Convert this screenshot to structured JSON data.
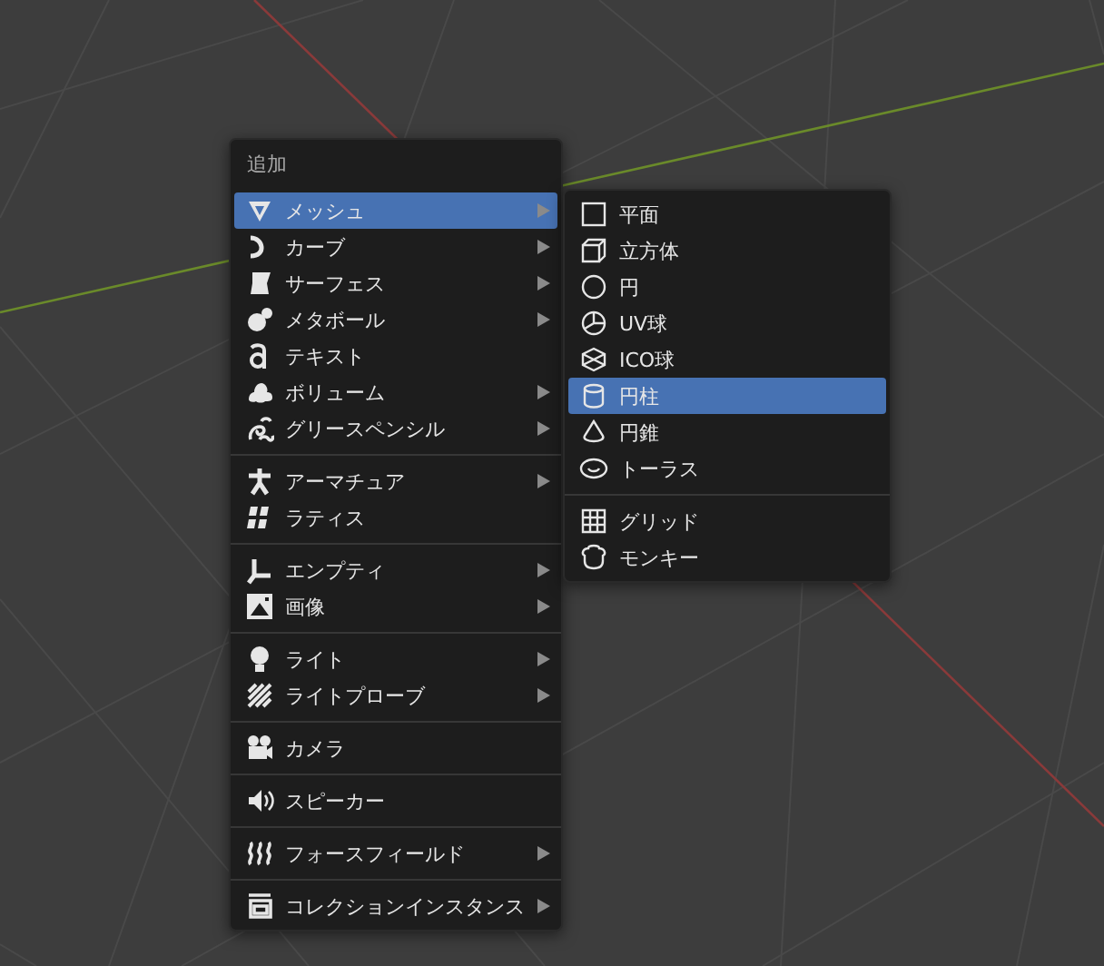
{
  "menu": {
    "title": "追加",
    "groups": [
      {
        "items": [
          {
            "label": "メッシュ",
            "submenu": true,
            "selected": true
          },
          {
            "label": "カーブ",
            "submenu": true,
            "selected": false
          },
          {
            "label": "サーフェス",
            "submenu": true,
            "selected": false
          },
          {
            "label": "メタボール",
            "submenu": true,
            "selected": false
          },
          {
            "label": "テキスト",
            "submenu": false,
            "selected": false
          },
          {
            "label": "ボリューム",
            "submenu": true,
            "selected": false
          },
          {
            "label": "グリースペンシル",
            "submenu": true,
            "selected": false
          }
        ]
      },
      {
        "items": [
          {
            "label": "アーマチュア",
            "submenu": true,
            "selected": false
          },
          {
            "label": "ラティス",
            "submenu": false,
            "selected": false
          }
        ]
      },
      {
        "items": [
          {
            "label": "エンプティ",
            "submenu": true,
            "selected": false
          },
          {
            "label": "画像",
            "submenu": true,
            "selected": false
          }
        ]
      },
      {
        "items": [
          {
            "label": "ライト",
            "submenu": true,
            "selected": false
          },
          {
            "label": "ライトプローブ",
            "submenu": true,
            "selected": false
          }
        ]
      },
      {
        "items": [
          {
            "label": "カメラ",
            "submenu": false,
            "selected": false
          }
        ]
      },
      {
        "items": [
          {
            "label": "スピーカー",
            "submenu": false,
            "selected": false
          }
        ]
      },
      {
        "items": [
          {
            "label": "フォースフィールド",
            "submenu": true,
            "selected": false
          }
        ]
      },
      {
        "items": [
          {
            "label": "コレクションインスタンス",
            "submenu": true,
            "selected": false
          }
        ]
      }
    ]
  },
  "submenu": {
    "groups": [
      {
        "items": [
          {
            "label": "平面",
            "selected": false
          },
          {
            "label": "立方体",
            "selected": false
          },
          {
            "label": "円",
            "selected": false
          },
          {
            "label": "UV球",
            "selected": false
          },
          {
            "label": "ICO球",
            "selected": false
          },
          {
            "label": "円柱",
            "selected": true
          },
          {
            "label": "円錐",
            "selected": false
          },
          {
            "label": "トーラス",
            "selected": false
          }
        ]
      },
      {
        "items": [
          {
            "label": "グリッド",
            "selected": false
          },
          {
            "label": "モンキー",
            "selected": false
          }
        ]
      }
    ]
  }
}
